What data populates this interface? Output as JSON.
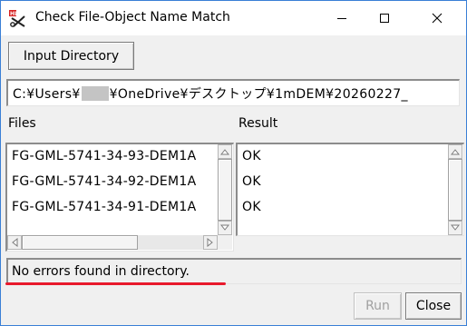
{
  "window": {
    "title": "Check File-Object Name Match"
  },
  "toolbar": {
    "input_directory_label": "Input Directory"
  },
  "path": {
    "prefix": "C:¥Users¥",
    "suffix": "¥OneDrive¥デスクトップ¥1mDEM¥20260227_"
  },
  "files": {
    "label": "Files",
    "items": [
      "FG-GML-5741-34-93-DEM1A",
      "FG-GML-5741-34-92-DEM1A",
      "FG-GML-5741-34-91-DEM1A"
    ]
  },
  "result": {
    "label": "Result",
    "items": [
      "OK",
      "OK",
      "OK"
    ]
  },
  "status": {
    "text": "No errors found in directory."
  },
  "buttons": {
    "run_label": "Run",
    "close_label": "Close"
  },
  "colors": {
    "accent_border": "#3a7fd6",
    "underline": "#e8192c",
    "disabled_text": "#a0a0a0"
  },
  "icons": {
    "app": "scissors-tool-icon",
    "minimize": "minimize-icon",
    "maximize": "maximize-icon",
    "close": "close-icon"
  }
}
